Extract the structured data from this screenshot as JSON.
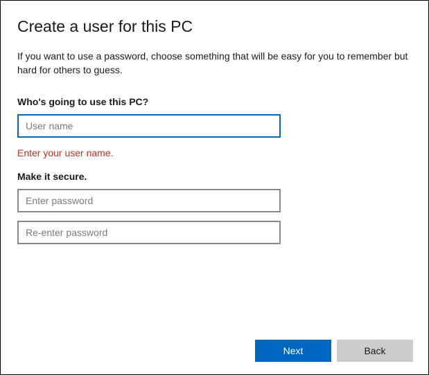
{
  "title": "Create a user for this PC",
  "description": "If you want to use a password, choose something that will be easy for you to remember but hard for others to guess.",
  "section_user": {
    "label": "Who's going to use this PC?",
    "placeholder": "User name",
    "error": "Enter your user name."
  },
  "section_password": {
    "label": "Make it secure.",
    "password_placeholder": "Enter password",
    "confirm_placeholder": "Re-enter password"
  },
  "buttons": {
    "next": "Next",
    "back": "Back"
  }
}
